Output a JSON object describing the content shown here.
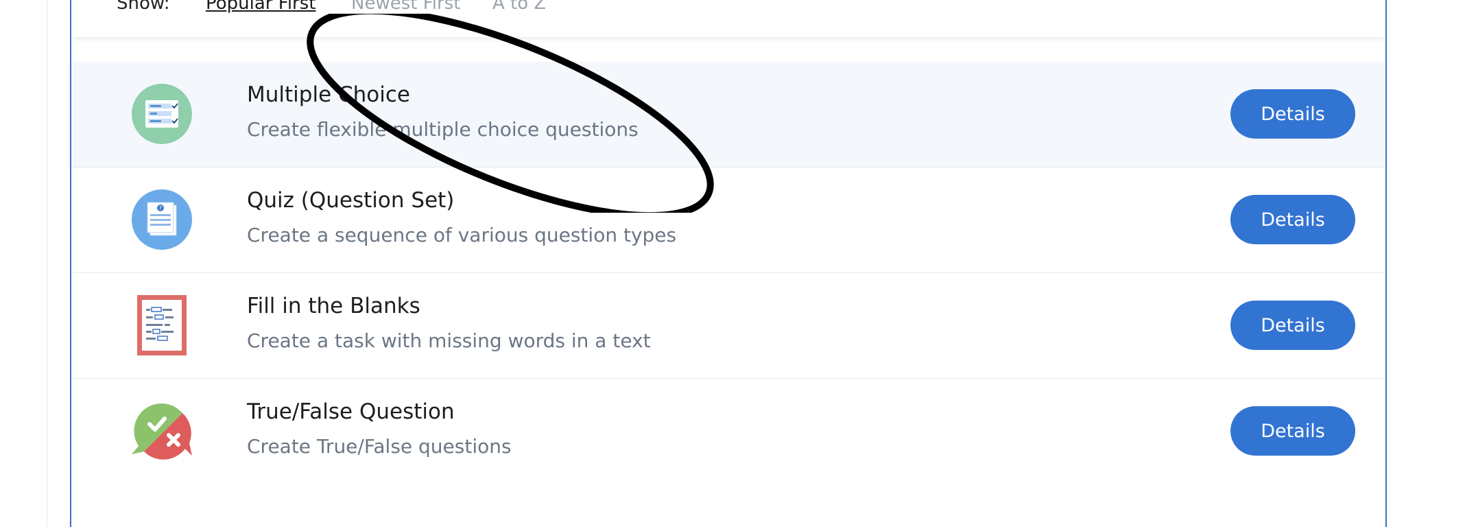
{
  "sort": {
    "label": "Show:",
    "options": [
      "Popular First",
      "Newest First",
      "A to Z"
    ]
  },
  "items": [
    {
      "title": "Multiple Choice",
      "description": "Create flexible multiple choice questions",
      "button": "Details",
      "icon": "multiple-choice-icon"
    },
    {
      "title": "Quiz (Question Set)",
      "description": "Create a sequence of various question types",
      "button": "Details",
      "icon": "question-set-icon"
    },
    {
      "title": "Fill in the Blanks",
      "description": "Create a task with missing words in a text",
      "button": "Details",
      "icon": "fill-blanks-icon"
    },
    {
      "title": "True/False Question",
      "description": "Create True/False questions",
      "button": "Details",
      "icon": "true-false-icon"
    }
  ],
  "colors": {
    "accent": "#3274d2",
    "border": "#3b72c6",
    "highlight_row": "#f4f8fd",
    "annotation": "#000000"
  }
}
